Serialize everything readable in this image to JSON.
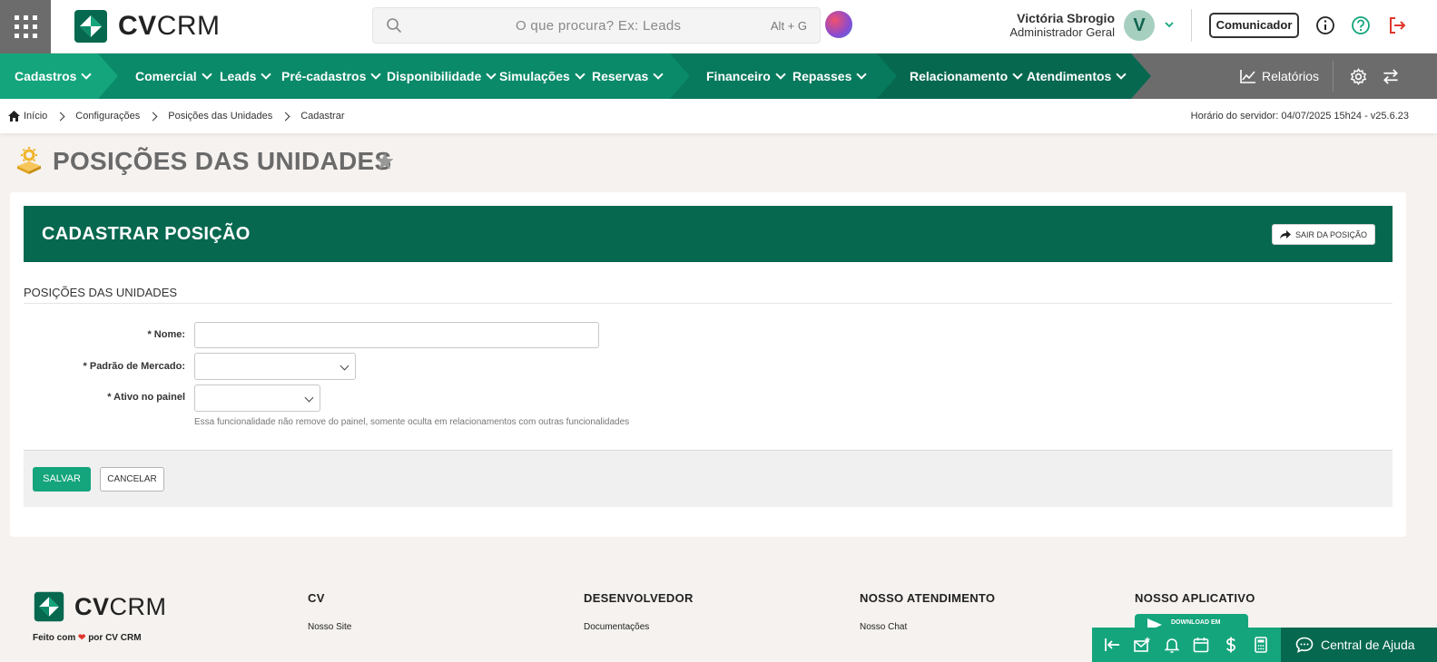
{
  "header": {
    "logo_bold": "CV",
    "logo_light": "CRM",
    "search_placeholder": "O que procura? Ex: Leads",
    "search_shortcut": "Alt + G",
    "user_name": "Victória Sbrogio",
    "user_role": "Administrador Geral",
    "avatar_letter": "V",
    "comunicador_label": "Comunicador"
  },
  "nav": {
    "items": [
      {
        "label": "Cadastros"
      },
      {
        "label": "Comercial"
      },
      {
        "label": "Leads"
      },
      {
        "label": "Pré-cadastros"
      },
      {
        "label": "Disponibilidade"
      },
      {
        "label": "Simulações"
      },
      {
        "label": "Reservas"
      },
      {
        "label": "Financeiro"
      },
      {
        "label": "Repasses"
      },
      {
        "label": "Relacionamento"
      },
      {
        "label": "Atendimentos"
      }
    ],
    "reports_label": "Relatórios",
    "colors": {
      "seg1": "#14a57c",
      "seg2": "#0a8a69",
      "seg3": "#07795c",
      "seg4": "#06684f",
      "rest": "#6c6c6c"
    }
  },
  "breadcrumb": {
    "items": [
      "Início",
      "Configurações",
      "Posições das Unidades",
      "Cadastrar"
    ],
    "server_time": "Horário do servidor: 04/07/2025 15h24 - v25.6.23"
  },
  "page": {
    "title": "POSIÇÕES DAS UNIDADES"
  },
  "form": {
    "header_title": "CADASTRAR POSIÇÃO",
    "exit_label": "SAIR DA POSIÇÃO",
    "section_title": "POSIÇÕES DAS UNIDADES",
    "fields": {
      "nome_label": "* Nome:",
      "nome_value": "",
      "padrao_label": "* Padrão de Mercado:",
      "padrao_value": "",
      "ativo_label": "* Ativo no painel",
      "ativo_value": "",
      "ativo_helper": "Essa funcionalidade não remove do painel, somente oculta em relacionamentos com outras funcionalidades"
    },
    "save_label": "SALVAR",
    "cancel_label": "CANCELAR"
  },
  "footer": {
    "made_with_prefix": "Feito com",
    "made_with_suffix": "por CV CRM",
    "columns": [
      {
        "title": "CV",
        "link": "Nosso Site"
      },
      {
        "title": "DESENVOLVEDOR",
        "link": "Documentações"
      },
      {
        "title": "NOSSO ATENDIMENTO",
        "link": "Nosso Chat"
      },
      {
        "title": "NOSSO APLICATIVO",
        "link": ""
      }
    ],
    "store_label": "DOWNLOAD EM",
    "help_label": "Central de Ajuda"
  },
  "accent_color": "#14a57c",
  "brand_dark": "#06684f"
}
